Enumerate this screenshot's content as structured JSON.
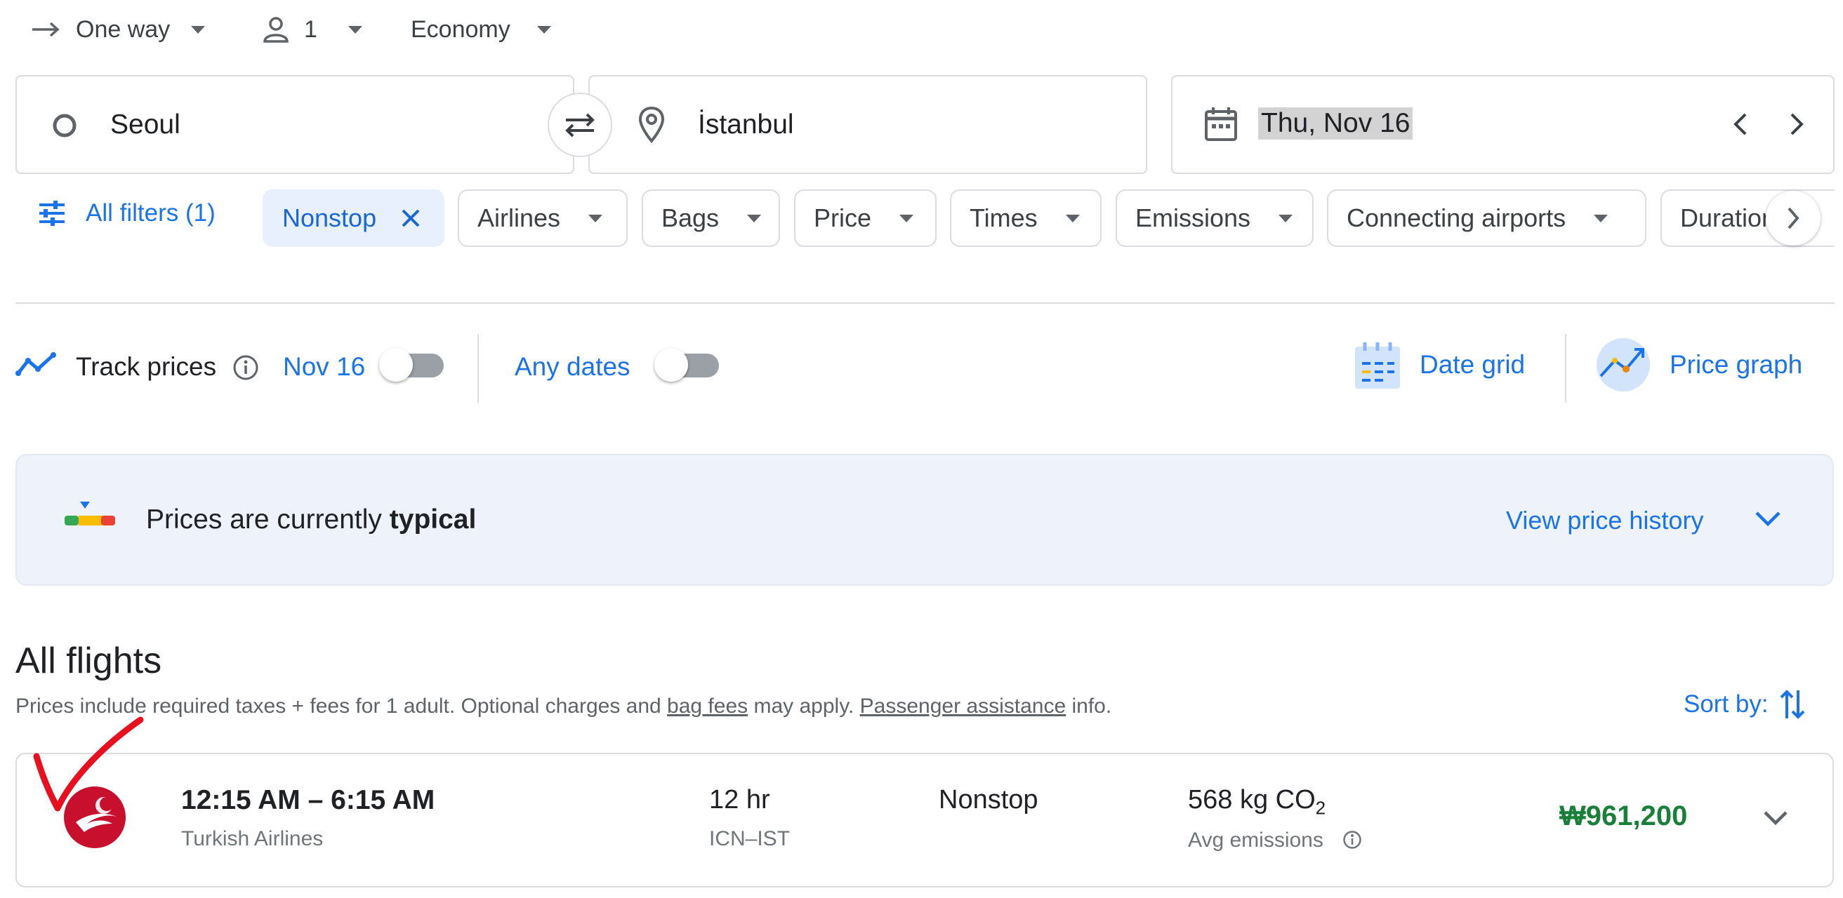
{
  "top_options": {
    "trip_type": "One way",
    "passengers": "1",
    "cabin": "Economy"
  },
  "search": {
    "origin": "Seoul",
    "destination": "İstanbul",
    "date": "Thu, Nov 16"
  },
  "filters": {
    "all_filters": "All filters (1)",
    "nonstop": "Nonstop",
    "airlines": "Airlines",
    "bags": "Bags",
    "price": "Price",
    "times": "Times",
    "emissions": "Emissions",
    "connecting_airports": "Connecting airports",
    "duration": "Duration"
  },
  "tracking": {
    "track_prices": "Track prices",
    "date": "Nov 16",
    "any_dates": "Any dates",
    "date_grid": "Date grid",
    "price_graph": "Price graph"
  },
  "price_banner": {
    "prefix": "Prices are currently ",
    "level": "typical",
    "history_link": "View price history"
  },
  "results": {
    "heading": "All flights",
    "disclaimer_1": "Prices include required taxes + fees for 1 adult. Optional charges and ",
    "bag_fees": "bag fees",
    "disclaimer_2": " may apply. ",
    "passenger_assistance": "Passenger assistance",
    "disclaimer_3": " info.",
    "sort_by": "Sort by:"
  },
  "flights": [
    {
      "times": "12:15 AM – 6:15 AM",
      "airline": "Turkish Airlines",
      "duration": "12 hr",
      "route": "ICN–IST",
      "stops": "Nonstop",
      "emissions_value": "568 kg CO",
      "emissions_sub": "2",
      "emissions_label": "Avg emissions",
      "price": "₩961,200"
    }
  ],
  "colors": {
    "accent": "#1a73e8",
    "price_green": "#188038",
    "airline_red": "#c8102e",
    "chip_selected_bg": "#e8f0fe",
    "banner_bg": "#eef3fb"
  }
}
